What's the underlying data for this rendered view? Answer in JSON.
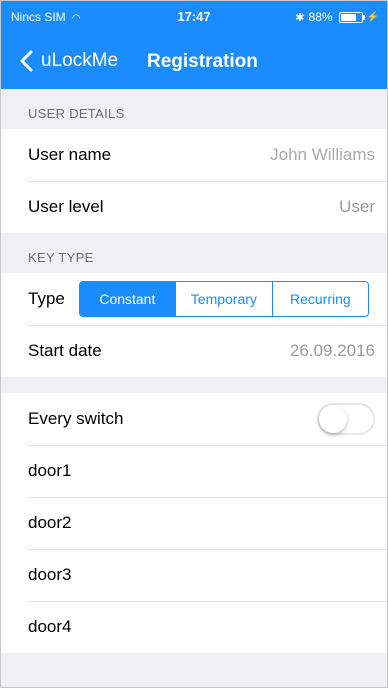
{
  "status_bar": {
    "carrier": "Nincs SIM",
    "time": "17:47",
    "battery": "88%",
    "battery_level": 0.88
  },
  "nav": {
    "back_label": "uLockMe",
    "title": "Registration"
  },
  "user_details": {
    "header": "USER DETAILS",
    "username_label": "User name",
    "username_placeholder": "John Williams",
    "level_label": "User level",
    "level_value": "User"
  },
  "key_type": {
    "header": "KEY TYPE",
    "type_label": "Type",
    "segments": [
      "Constant",
      "Temporary",
      "Recurring"
    ],
    "selected": "Constant",
    "start_date_label": "Start date",
    "start_date_value": "26.09.2016"
  },
  "switches": {
    "every_switch_label": "Every switch",
    "every_switch_on": false,
    "doors": [
      "door1",
      "door2",
      "door3",
      "door4"
    ]
  },
  "colors": {
    "accent": "#1a8cff",
    "background": "#efeff4"
  },
  "icons": [
    "wifi-icon",
    "bluetooth-icon",
    "battery-icon",
    "charging-icon",
    "chevron-left-icon"
  ]
}
